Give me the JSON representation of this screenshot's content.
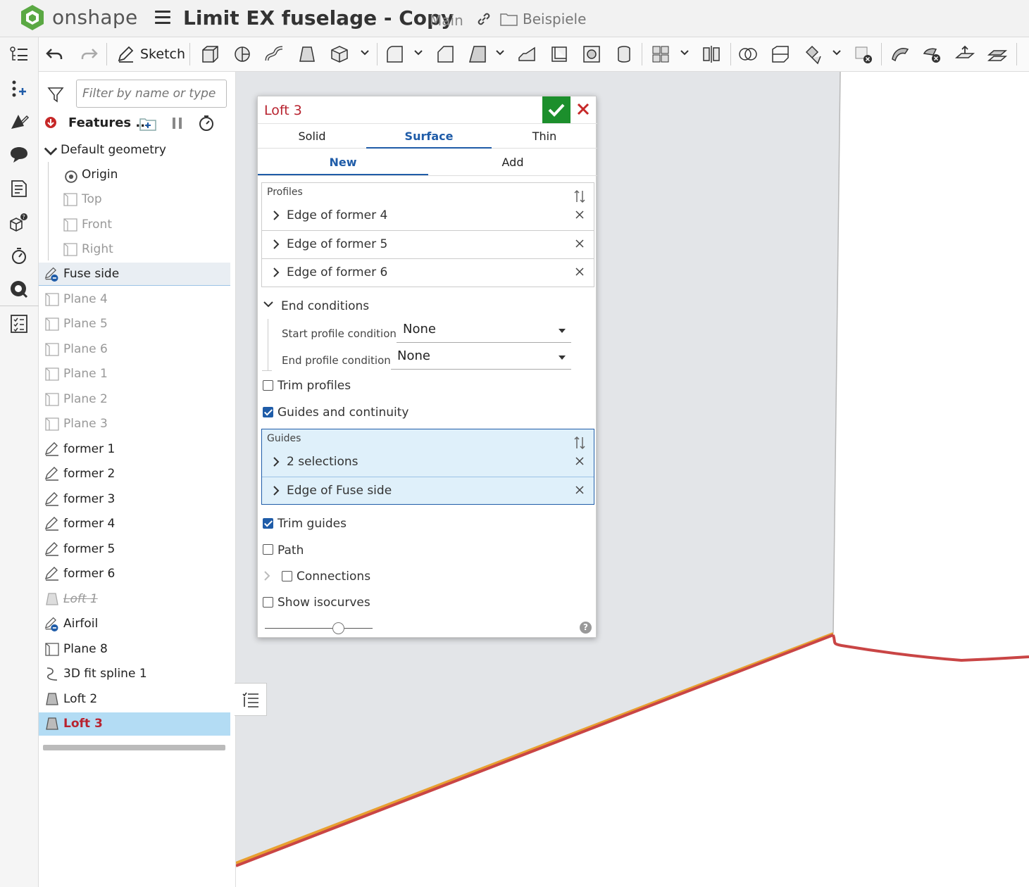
{
  "app": {
    "brand": "onshape",
    "document_title": "Limit EX fuselage - Copy",
    "branch": "Main",
    "folder": "Beispiele"
  },
  "toolbar": {
    "sketch_label": "Sketch"
  },
  "filter": {
    "placeholder": "Filter by name or type"
  },
  "features": {
    "title": "Features ...",
    "default_geometry": "Default geometry",
    "items": [
      {
        "label": "Origin"
      },
      {
        "label": "Top"
      },
      {
        "label": "Front"
      },
      {
        "label": "Right"
      },
      {
        "label": "Fuse side"
      },
      {
        "label": "Plane 4"
      },
      {
        "label": "Plane 5"
      },
      {
        "label": "Plane 6"
      },
      {
        "label": "Plane 1"
      },
      {
        "label": "Plane 2"
      },
      {
        "label": "Plane 3"
      },
      {
        "label": "former 1"
      },
      {
        "label": "former 2"
      },
      {
        "label": "former 3"
      },
      {
        "label": "former 4"
      },
      {
        "label": "former 5"
      },
      {
        "label": "former 6"
      },
      {
        "label": "Loft 1"
      },
      {
        "label": "Airfoil"
      },
      {
        "label": "Plane 8"
      },
      {
        "label": "3D fit spline 1"
      },
      {
        "label": "Loft 2"
      },
      {
        "label": "Loft 3"
      }
    ]
  },
  "dialog": {
    "title": "Loft 3",
    "tabs": [
      "Solid",
      "Surface",
      "Thin"
    ],
    "subtabs": [
      "New",
      "Add"
    ],
    "profiles": {
      "header": "Profiles",
      "rows": [
        "Edge of former 4",
        "Edge of former 5",
        "Edge of former 6"
      ]
    },
    "end_conditions": {
      "label": "End conditions",
      "start_label": "Start profile condition",
      "start_value": "None",
      "end_label": "End profile condition",
      "end_value": "None"
    },
    "trim_profiles": {
      "label": "Trim profiles",
      "checked": false
    },
    "guides_continuity": {
      "label": "Guides and continuity",
      "checked": true
    },
    "guides": {
      "header": "Guides",
      "rows": [
        "2 selections",
        "Edge of Fuse side"
      ]
    },
    "trim_guides": {
      "label": "Trim guides",
      "checked": true
    },
    "path": {
      "label": "Path",
      "checked": false
    },
    "connections": {
      "label": "Connections",
      "checked": false
    },
    "show_isocurves": {
      "label": "Show isocurves",
      "checked": false
    },
    "help": "?"
  },
  "colors": {
    "accent": "#1f5ca8",
    "active_feature": "#b8232f",
    "ok": "#1c8f2c",
    "logo": "#4caf50"
  }
}
